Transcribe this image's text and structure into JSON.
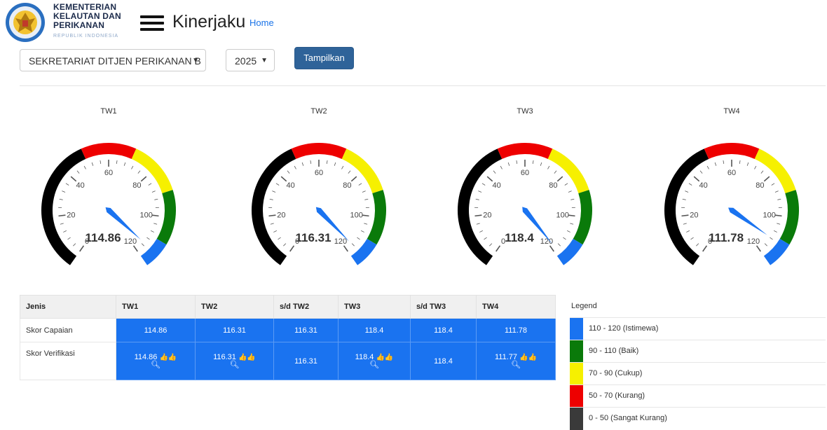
{
  "header": {
    "org_line1": "KEMENTERIAN",
    "org_line2": "KELAUTAN DAN",
    "org_line3": "PERIKANAN",
    "org_sub": "REPUBLIK INDONESIA",
    "app_title": "Kinerjaku",
    "home_link": "Home"
  },
  "filters": {
    "unit_value": "SEKRETARIAT DITJEN PERIKANAN B",
    "year_value": "2025",
    "show_button": "Tampilkan"
  },
  "gauges": [
    {
      "title": "TW1",
      "value": 114.86,
      "label": "114.86"
    },
    {
      "title": "TW2",
      "value": 116.31,
      "label": "116.31"
    },
    {
      "title": "TW3",
      "value": 118.4,
      "label": "118.4"
    },
    {
      "title": "TW4",
      "value": 111.78,
      "label": "111.78"
    }
  ],
  "gauge_scale": {
    "min": 0,
    "max": 120,
    "tick_labels": [
      "0",
      "20",
      "40",
      "60",
      "80",
      "100",
      "120"
    ],
    "bands": [
      {
        "from": 0,
        "to": 50,
        "color": "#000000"
      },
      {
        "from": 50,
        "to": 70,
        "color": "#ee0000"
      },
      {
        "from": 70,
        "to": 90,
        "color": "#f6f000"
      },
      {
        "from": 90,
        "to": 110,
        "color": "#0a7a0a"
      },
      {
        "from": 110,
        "to": 120,
        "color": "#1a73f0"
      }
    ],
    "needle_color": "#1a73f0"
  },
  "table": {
    "headers": [
      "Jenis",
      "TW1",
      "TW2",
      "s/d TW2",
      "TW3",
      "s/d TW3",
      "TW4"
    ],
    "capaian": {
      "label": "Skor Capaian",
      "values": [
        "114.86",
        "116.31",
        "116.31",
        "118.4",
        "118.4",
        "111.78"
      ]
    },
    "verifikasi": {
      "label": "Skor Verifikasi",
      "values": [
        "114.86",
        "116.31",
        "116.31",
        "118.4",
        "118.4",
        "111.77"
      ]
    }
  },
  "legend": {
    "title": "Legend",
    "items": [
      {
        "label": "110 - 120 (Istimewa)",
        "color": "#1a73f0"
      },
      {
        "label": "90 - 110 (Baik)",
        "color": "#0a7a0a"
      },
      {
        "label": "70 - 90 (Cukup)",
        "color": "#f6f000"
      },
      {
        "label": "50 - 70 (Kurang)",
        "color": "#ee0000"
      },
      {
        "label": "0 - 50 (Sangat Kurang)",
        "color": "#3a3a3a"
      }
    ]
  }
}
